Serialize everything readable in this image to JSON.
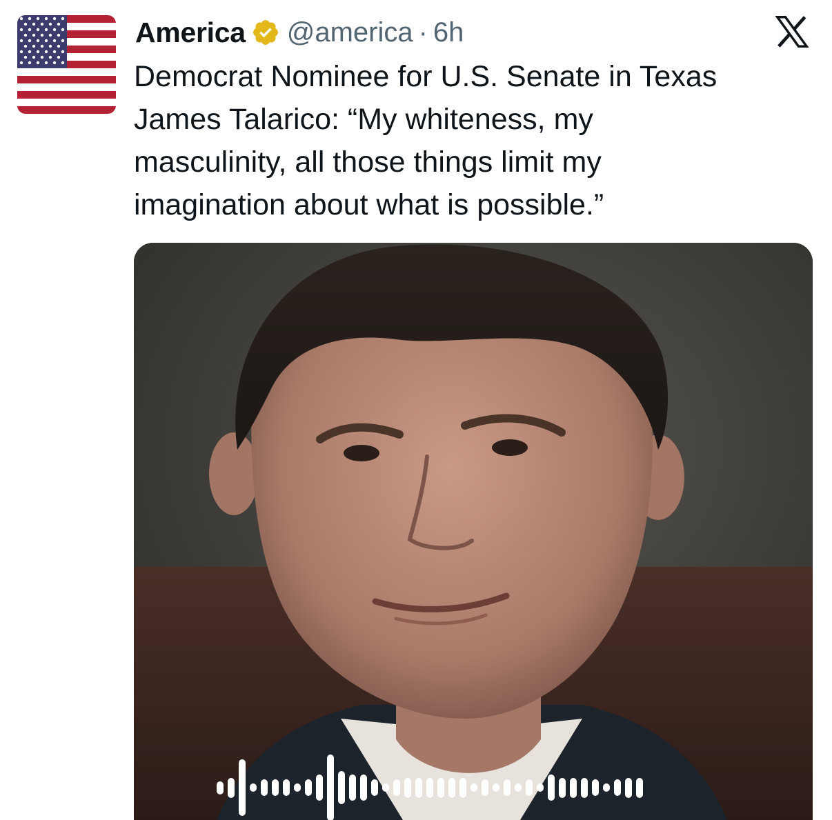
{
  "account": {
    "display_name": "America",
    "handle": "@america",
    "separator": "·",
    "time": "6h",
    "verified_icon": "verified-badge-gold-icon",
    "avatar_icon": "us-flag-icon"
  },
  "brand": {
    "logo_icon": "x-logo-icon"
  },
  "tweet": {
    "text": "Democrat Nominee for U.S. Senate in Texas\nJames Talarico: “My whiteness, my\nmasculinity, all those things limit my\nimagination about what is possible.”"
  },
  "media": {
    "type": "video-with-audio-waveform",
    "waveform_icon": "audio-waveform-icon",
    "waveform_levels": [
      0.2,
      0.3,
      0.85,
      0.12,
      0.25,
      0.25,
      0.25,
      0.12,
      0.25,
      0.4,
      1.0,
      0.5,
      0.4,
      0.4,
      0.25,
      0.12,
      0.25,
      0.3,
      0.3,
      0.3,
      0.3,
      0.3,
      0.3,
      0.12,
      0.25,
      0.12,
      0.25,
      0.12,
      0.25,
      0.12,
      0.4,
      0.3,
      0.3,
      0.3,
      0.25,
      0.12,
      0.25,
      0.3,
      0.3
    ]
  },
  "colors": {
    "text_primary": "#0f1419",
    "text_secondary": "#536471",
    "verified_gold": "#e2b719",
    "flag_red": "#b22234",
    "flag_blue": "#3c3b6e"
  }
}
